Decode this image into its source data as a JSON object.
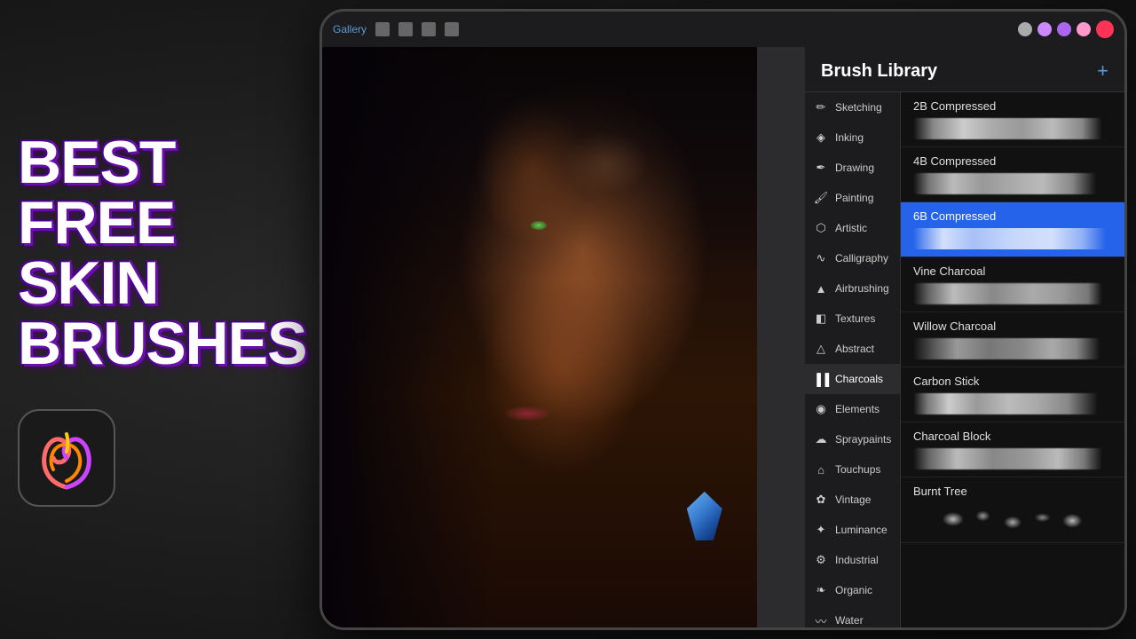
{
  "background": {
    "color": "#1a1a1a"
  },
  "headline": {
    "line1": "BEST FREE",
    "line2": "SKIN",
    "line3": "BRUSHES"
  },
  "ipad": {
    "topbar": {
      "gallery_label": "Gallery",
      "color_dots": [
        "#ff6b6b",
        "#cc88ff",
        "#aa66ee",
        "#ff99cc",
        "#ff3355"
      ]
    }
  },
  "brush_library": {
    "title": "Brush Library",
    "add_button": "+",
    "categories": [
      {
        "id": "sketching",
        "label": "Sketching",
        "icon": "pencil"
      },
      {
        "id": "inking",
        "label": "Inking",
        "icon": "pen"
      },
      {
        "id": "drawing",
        "label": "Drawing",
        "icon": "draw"
      },
      {
        "id": "painting",
        "label": "Painting",
        "icon": "brush"
      },
      {
        "id": "artistic",
        "label": "Artistic",
        "icon": "palette"
      },
      {
        "id": "calligraphy",
        "label": "Calligraphy",
        "icon": "script"
      },
      {
        "id": "airbrushing",
        "label": "Airbrushing",
        "icon": "spray"
      },
      {
        "id": "textures",
        "label": "Textures",
        "icon": "texture"
      },
      {
        "id": "abstract",
        "label": "Abstract",
        "icon": "triangle"
      },
      {
        "id": "charcoals",
        "label": "Charcoals",
        "icon": "bars",
        "active": true
      },
      {
        "id": "elements",
        "label": "Elements",
        "icon": "circle"
      },
      {
        "id": "spraypaints",
        "label": "Spraypaints",
        "icon": "spray2"
      },
      {
        "id": "touchups",
        "label": "Touchups",
        "icon": "hat"
      },
      {
        "id": "vintage",
        "label": "Vintage",
        "icon": "clock"
      },
      {
        "id": "luminance",
        "label": "Luminance",
        "icon": "star"
      },
      {
        "id": "industrial",
        "label": "Industrial",
        "icon": "gear"
      },
      {
        "id": "organic",
        "label": "Organic",
        "icon": "leaf"
      },
      {
        "id": "water",
        "label": "Water",
        "icon": "wave"
      }
    ],
    "brushes": [
      {
        "id": "2b",
        "name": "2B Compressed",
        "stroke_class": "stroke-2b",
        "selected": false
      },
      {
        "id": "4b",
        "name": "4B Compressed",
        "stroke_class": "stroke-4b",
        "selected": false
      },
      {
        "id": "6b",
        "name": "6B Compressed",
        "stroke_class": "stroke-6b",
        "selected": true
      },
      {
        "id": "vine",
        "name": "Vine Charcoal",
        "stroke_class": "stroke-vine",
        "selected": false
      },
      {
        "id": "willow",
        "name": "Willow Charcoal",
        "stroke_class": "stroke-willow",
        "selected": false
      },
      {
        "id": "carbon",
        "name": "Carbon Stick",
        "stroke_class": "stroke-carbon",
        "selected": false
      },
      {
        "id": "block",
        "name": "Charcoal Block",
        "stroke_class": "stroke-block",
        "selected": false
      },
      {
        "id": "burnt",
        "name": "Burnt Tree",
        "stroke_class": "stroke-burnt",
        "selected": false
      }
    ]
  },
  "category_icons": {
    "pencil": "✏️",
    "pen": "🖋",
    "draw": "✒️",
    "brush": "🖌",
    "palette": "🎨",
    "script": "📝",
    "spray": "💨",
    "texture": "◼",
    "triangle": "△",
    "bars": "▐▐▐",
    "circle": "◉",
    "spray2": "💬",
    "hat": "🎩",
    "clock": "🕐",
    "star": "✦",
    "gear": "⚙",
    "leaf": "🌿",
    "wave": "〰"
  }
}
